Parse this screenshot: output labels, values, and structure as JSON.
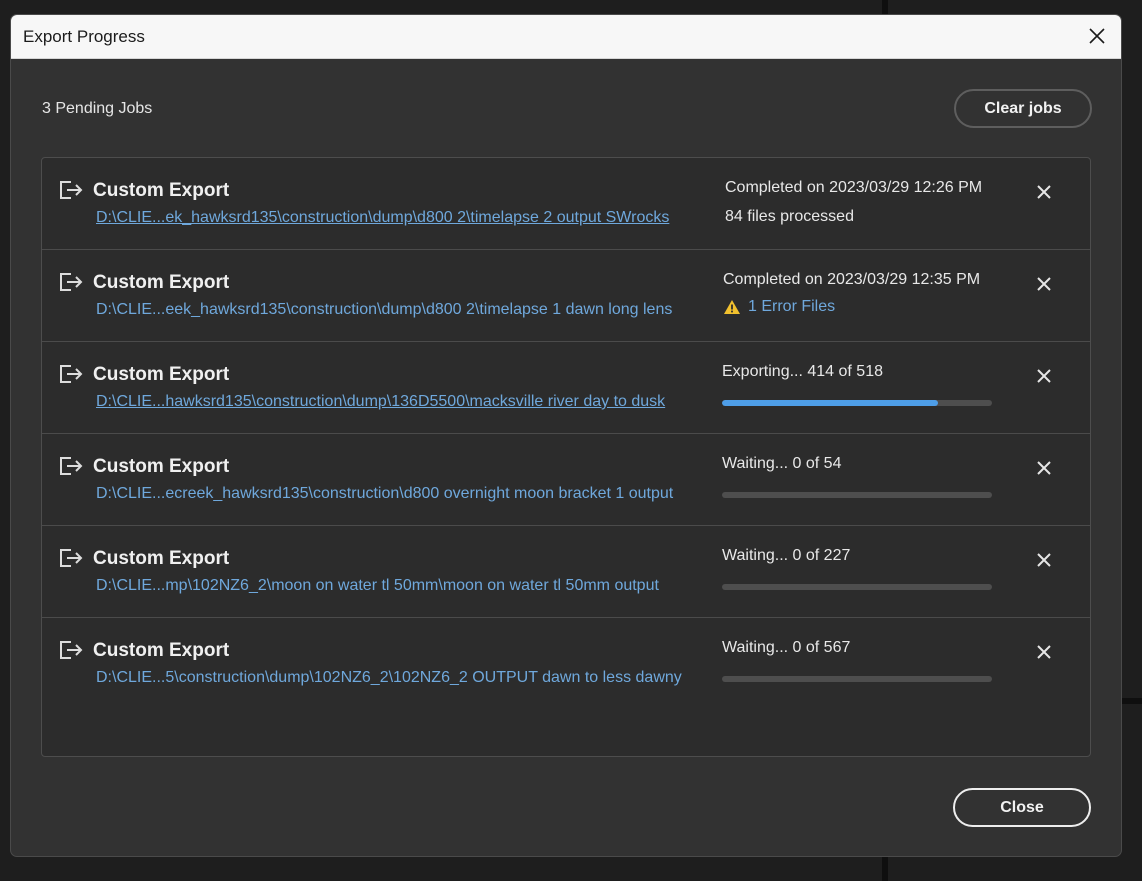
{
  "window": {
    "title": "Export Progress"
  },
  "header": {
    "pending_text": "3 Pending Jobs",
    "clear_label": "Clear jobs"
  },
  "footer": {
    "close_label": "Close"
  },
  "colors": {
    "accent": "#4e9ee8",
    "link": "#6fa8dc",
    "warning": "#f2c12e"
  },
  "jobs": [
    {
      "title": "Custom Export",
      "path": "D:\\CLIE...ek_hawksrd135\\construction\\dump\\d800 2\\timelapse 2 output SWrocks",
      "status": "Completed on 2023/03/29 12:26 PM",
      "detail": "84 files processed",
      "icon": "export-icon"
    },
    {
      "title": "Custom Export",
      "path": "D:\\CLIE...eek_hawksrd135\\construction\\dump\\d800 2\\timelapse 1 dawn long lens",
      "status": "Completed on 2023/03/29 12:35 PM",
      "detail": "1 Error Files",
      "icon": "export-icon"
    },
    {
      "title": "Custom Export",
      "path": "D:\\CLIE...hawksrd135\\construction\\dump\\136D5500\\macksville river day to dusk",
      "status": "Exporting... 414 of 518",
      "progress": 0.799,
      "icon": "export-icon"
    },
    {
      "title": "Custom Export",
      "path": "D:\\CLIE...ecreek_hawksrd135\\construction\\d800 overnight moon bracket 1 output",
      "status": "Waiting... 0 of 54",
      "progress": 0,
      "icon": "export-icon"
    },
    {
      "title": "Custom Export",
      "path": "D:\\CLIE...mp\\102NZ6_2\\moon on water tl 50mm\\moon on water tl 50mm output",
      "status": "Waiting... 0 of 227",
      "progress": 0,
      "icon": "export-icon"
    },
    {
      "title": "Custom Export",
      "path": "D:\\CLIE...5\\construction\\dump\\102NZ6_2\\102NZ6_2 OUTPUT dawn to less dawny",
      "status": "Waiting... 0 of 567",
      "progress": 0,
      "icon": "export-icon"
    }
  ]
}
